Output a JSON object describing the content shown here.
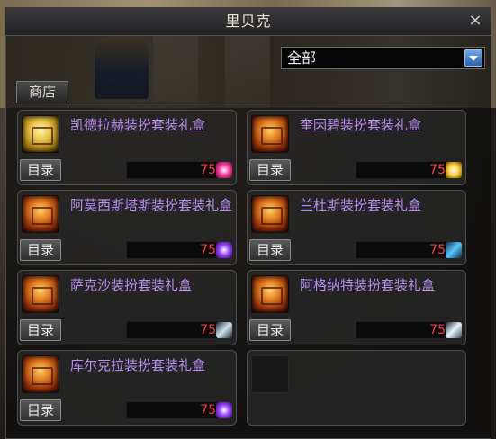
{
  "window": {
    "title": "里贝克",
    "close_icon": "×"
  },
  "filter": {
    "selected": "全部"
  },
  "tabs": [
    {
      "label": "商店"
    }
  ],
  "items": [
    {
      "name": "凯德拉赫装扮套装礼盒",
      "catalog_label": "目录",
      "level": "75",
      "icon": "gold-giftbox-icon",
      "badge": "pink-gem-icon"
    },
    {
      "name": "奎因碧装扮套装礼盒",
      "catalog_label": "目录",
      "level": "75",
      "icon": "giftbox-icon",
      "badge": "gold-badge-icon"
    },
    {
      "name": "阿莫西斯塔斯装扮套装礼盒",
      "catalog_label": "目录",
      "level": "75",
      "icon": "giftbox-icon",
      "badge": "purple-orb-icon"
    },
    {
      "name": "兰杜斯装扮套装礼盒",
      "catalog_label": "目录",
      "level": "75",
      "icon": "giftbox-icon",
      "badge": "blue-wind-icon"
    },
    {
      "name": "萨克沙装扮套装礼盒",
      "catalog_label": "目录",
      "level": "75",
      "icon": "giftbox-icon",
      "badge": "sword-icon"
    },
    {
      "name": "阿格纳特装扮套装礼盒",
      "catalog_label": "目录",
      "level": "75",
      "icon": "giftbox-icon",
      "badge": "ice-icon"
    },
    {
      "name": "库尔克拉装扮套装礼盒",
      "catalog_label": "目录",
      "level": "75",
      "icon": "giftbox-icon",
      "badge": "purple-orb-icon"
    }
  ]
}
